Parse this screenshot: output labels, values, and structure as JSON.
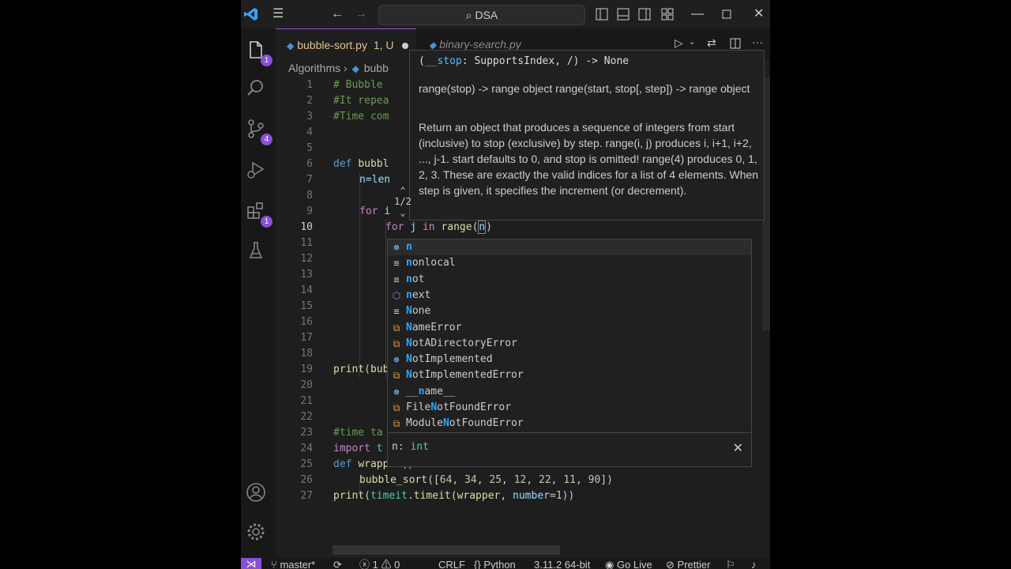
{
  "titlebar": {
    "search_text": "DSA"
  },
  "activity": {
    "explorer_badge": "1",
    "scm_badge": "4",
    "extensions_badge": "1"
  },
  "tabs": [
    {
      "label": "bubble-sort.py",
      "status": "1, U"
    },
    {
      "label": "binary-search.py"
    }
  ],
  "breadcrumb": {
    "folder": "Algorithms",
    "file": "bubb"
  },
  "editor": {
    "lines": [
      {
        "n": "1",
        "text": "# Bubble"
      },
      {
        "n": "2",
        "text": "#It repea"
      },
      {
        "n": "3",
        "text": "#Time com"
      },
      {
        "n": "4",
        "text": ""
      },
      {
        "n": "5",
        "text": ""
      },
      {
        "n": "6",
        "text": "def bubbl"
      },
      {
        "n": "7",
        "text": "n=len"
      },
      {
        "n": "8",
        "text": ""
      },
      {
        "n": "9",
        "text": "for i"
      },
      {
        "n": "10",
        "text": "for j in range(n)"
      },
      {
        "n": "11",
        "text": ""
      },
      {
        "n": "12",
        "text": ""
      },
      {
        "n": "13",
        "text": ""
      },
      {
        "n": "14",
        "text": ""
      },
      {
        "n": "15",
        "text": ""
      },
      {
        "n": "16",
        "text": ""
      },
      {
        "n": "17",
        "text": ""
      },
      {
        "n": "18",
        "text": ""
      },
      {
        "n": "19",
        "text": "print(bub"
      },
      {
        "n": "20",
        "text": ""
      },
      {
        "n": "21",
        "text": ""
      },
      {
        "n": "22",
        "text": ""
      },
      {
        "n": "23",
        "text": "#time ta"
      },
      {
        "n": "24",
        "text": "import t"
      },
      {
        "n": "25",
        "text": "def wrapper():"
      },
      {
        "n": "26",
        "text": "bubble_sort([64, 34, 25, 12, 22, 11, 90])"
      },
      {
        "n": "27",
        "text": "print(timeit.timeit(wrapper, number=1))"
      }
    ]
  },
  "hover": {
    "signature": "(__stop: SupportsIndex, /) -> None",
    "sig_open": "(",
    "sig_param": "__stop",
    "sig_rest": ": SupportsIndex, /) -> None",
    "para1": "range(stop) -> range object range(start, stop[, step]) -> range object",
    "para2": "Return an object that produces a sequence of integers from start (inclusive) to stop (exclusive) by step. range(i, j) produces i, i+1, i+2, ..., j-1. start defaults to 0, and stop is omitted! range(4) produces 0, 1, 2, 3. These are exactly the valid indices for a list of 4 elements. When step is given, it specifies the increment (or decrement).",
    "pager": "1/2"
  },
  "suggest": {
    "items": [
      {
        "label": "n",
        "kind": "variable"
      },
      {
        "label": "nonlocal",
        "kind": "keyword"
      },
      {
        "label": "not",
        "kind": "keyword"
      },
      {
        "label": "next",
        "kind": "function"
      },
      {
        "label": "None",
        "kind": "keyword"
      },
      {
        "label": "NameError",
        "kind": "class"
      },
      {
        "label": "NotADirectoryError",
        "kind": "class"
      },
      {
        "label": "NotImplemented",
        "kind": "variable"
      },
      {
        "label": "NotImplementedError",
        "kind": "class"
      },
      {
        "label": "__name__",
        "kind": "variable"
      },
      {
        "label": "FileNotFoundError",
        "kind": "class"
      },
      {
        "label": "ModuleNotFoundError",
        "kind": "class"
      }
    ],
    "detail_name": "n:",
    "detail_type": "int"
  },
  "status": {
    "branch": "master*",
    "errors": "1",
    "warnings": "0",
    "eol": "CRLF",
    "language": "Python",
    "interpreter": "3.11.2 64-bit",
    "golive": "Go Live",
    "prettier": "Prettier"
  },
  "colors": {
    "accent": "#8a4fd8",
    "match": "#2aaaff",
    "modified": "#e2c08d"
  }
}
